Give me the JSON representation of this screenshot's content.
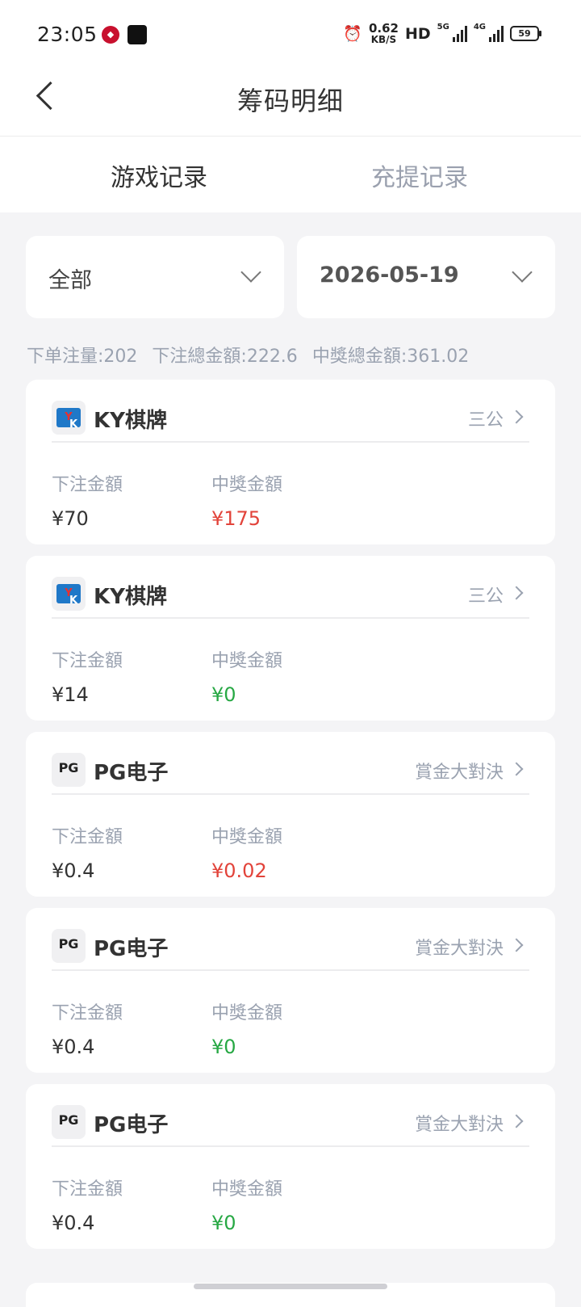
{
  "status_bar": {
    "time": "23:05",
    "speed_value": "0.62",
    "speed_unit": "KB/S",
    "hd": "HD",
    "net1": "5G",
    "net2": "4G",
    "battery": "59"
  },
  "header": {
    "title": "筹码明细"
  },
  "tabs": [
    {
      "label": "游戏记录",
      "active": true
    },
    {
      "label": "充提记录",
      "active": false
    }
  ],
  "filters": {
    "category": "全部",
    "date": "2026-05-19"
  },
  "summary": {
    "order_count": "下单注量:202",
    "bet_total": "下注總金額:222.6",
    "win_total": "中獎總金額:361.02"
  },
  "labels": {
    "bet": "下注金額",
    "win": "中獎金額"
  },
  "records": [
    {
      "provider": "KY棋牌",
      "logo": "ky-logo-icon",
      "game": "三公",
      "bet": "¥70",
      "win": "¥175",
      "win_color": "#e2433a"
    },
    {
      "provider": "KY棋牌",
      "logo": "ky-logo-icon",
      "game": "三公",
      "bet": "¥14",
      "win": "¥0",
      "win_color": "#27a844"
    },
    {
      "provider": "PG电子",
      "logo": "pg-logo-icon",
      "game": "賞金大對決",
      "bet": "¥0.4",
      "win": "¥0.02",
      "win_color": "#e2433a"
    },
    {
      "provider": "PG电子",
      "logo": "pg-logo-icon",
      "game": "賞金大對決",
      "bet": "¥0.4",
      "win": "¥0",
      "win_color": "#27a844"
    },
    {
      "provider": "PG电子",
      "logo": "pg-logo-icon",
      "game": "賞金大對決",
      "bet": "¥0.4",
      "win": "¥0",
      "win_color": "#27a844"
    }
  ],
  "logos": {
    "ky_text_k": "K",
    "ky_text_y": "Y",
    "pg_text": "PG"
  }
}
